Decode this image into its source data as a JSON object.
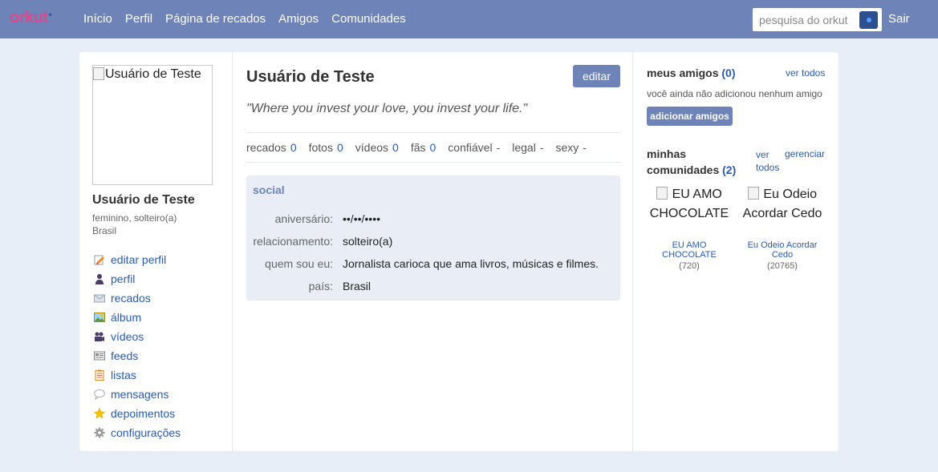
{
  "topbar": {
    "logo": "orkut",
    "logo_dot": "•",
    "nav": [
      "Início",
      "Perfil",
      "Página de recados",
      "Amigos",
      "Comunidades"
    ],
    "search_placeholder": "pesquisa do orkut",
    "logout": "Sair"
  },
  "profile": {
    "photo_alt": "Usuário de Teste",
    "name": "Usuário de Teste",
    "info_line1": "feminino, solteiro(a)",
    "info_line2": "Brasil"
  },
  "menu": [
    {
      "label": "editar perfil",
      "icon": "edit-profile-icon"
    },
    {
      "label": "perfil",
      "icon": "user-icon"
    },
    {
      "label": "recados",
      "icon": "envelope-icon"
    },
    {
      "label": "álbum",
      "icon": "picture-icon"
    },
    {
      "label": "vídeos",
      "icon": "video-camera-icon"
    },
    {
      "label": "feeds",
      "icon": "feed-icon"
    },
    {
      "label": "listas",
      "icon": "clipboard-icon"
    },
    {
      "label": "mensagens",
      "icon": "speech-bubble-icon"
    },
    {
      "label": "depoimentos",
      "icon": "star-icon"
    },
    {
      "label": "configurações",
      "icon": "gear-icon"
    }
  ],
  "main": {
    "title": "Usuário de Teste",
    "edit_label": "editar",
    "quote": "\"Where you invest your love, you invest your life.\"",
    "stats": [
      {
        "label": "recados",
        "value": "0"
      },
      {
        "label": "fotos",
        "value": "0"
      },
      {
        "label": "vídeos",
        "value": "0"
      },
      {
        "label": "fãs",
        "value": "0"
      },
      {
        "label": "confiável",
        "value": "-"
      },
      {
        "label": "legal",
        "value": "-"
      },
      {
        "label": "sexy",
        "value": "-"
      }
    ],
    "social": {
      "title": "social",
      "rows": [
        {
          "label": "aniversário:",
          "value": "••/••/••••"
        },
        {
          "label": "relacionamento:",
          "value": "solteiro(a)"
        },
        {
          "label": "quem sou eu:",
          "value": "Jornalista carioca que ama livros, músicas e filmes."
        },
        {
          "label": "país:",
          "value": "Brasil"
        }
      ]
    }
  },
  "friends": {
    "title": "meus amigos",
    "count": "(0)",
    "see_all": "ver todos",
    "note": "você ainda não adicionou nenhum amigo",
    "add_label": "adicionar amigos"
  },
  "communities": {
    "title_line1": "minhas",
    "title_line2": "comunidades",
    "count": "(2)",
    "see_all_line1": "ver",
    "see_all_line2": "todos",
    "manage": "gerenciar",
    "items": [
      {
        "alt": "EU AMO CHOCOLATE",
        "name": "EU AMO CHOCOLATE",
        "members": "(720)"
      },
      {
        "alt": "Eu Odeio Acordar Cedo",
        "name": "Eu Odeio Acordar Cedo",
        "members": "(20765)"
      }
    ]
  },
  "colors": {
    "topbar": "#6e83b7",
    "logo": "#e0488c",
    "link": "#2a5ab5",
    "background": "#e8eef8",
    "social_box": "#e8edf6"
  }
}
